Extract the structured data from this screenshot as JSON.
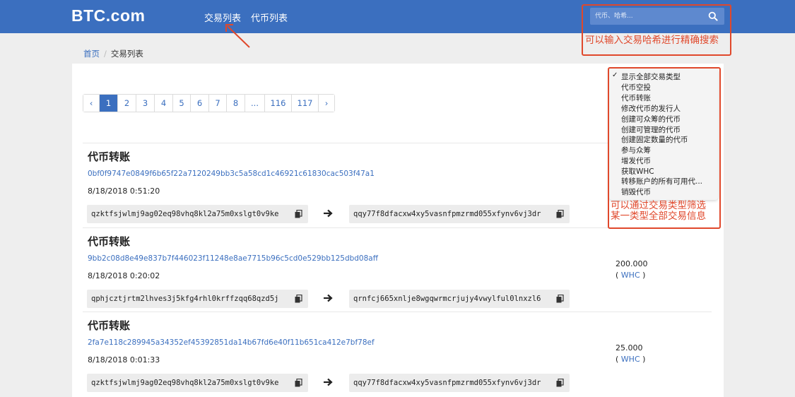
{
  "header": {
    "logo": "BTC.com",
    "nav": [
      "交易列表",
      "代币列表"
    ],
    "search_placeholder": "代币、哈希..."
  },
  "annotations": {
    "search": "可以输入交易哈希进行精确搜索",
    "filter_line1": "可以通过交易类型筛选",
    "filter_line2": "某一类型全部交易信息"
  },
  "breadcrumb": {
    "home": "首页",
    "separator": "/",
    "current": "交易列表"
  },
  "pagination": {
    "prev": "‹",
    "pages": [
      "1",
      "2",
      "3",
      "4",
      "5",
      "6",
      "7",
      "8",
      "...",
      "116",
      "117"
    ],
    "next": "›",
    "active": "1"
  },
  "filter_menu": {
    "selected": "显示全部交易类型",
    "options": [
      "显示全部交易类型",
      "代币空投",
      "代币转账",
      "修改代币的发行人",
      "创建可众筹的代币",
      "创建可管理的代币",
      "创建固定数量的代币",
      "参与众筹",
      "增发代币",
      "获取WHC",
      "转移账户的所有可用代...",
      "销毁代币"
    ]
  },
  "transactions": [
    {
      "type": "代币转账",
      "hash": "0bf0f9747e0849f6b65f22a7120249bb3c5a58cd1c46921c61830cac503f47a1",
      "time": "8/18/2018 0:51:20",
      "from": "qzktfsjwlmj9ag02eq98vhq8kl2a75m0xslgt0v9ke",
      "to": "qqy77f8dfacxw4xy5vasnfpmzrmd055xfynv6vj3dr",
      "amount": "",
      "token": ""
    },
    {
      "type": "代币转账",
      "hash": "9bb2c08d8e49e837b7f446023f11248e8ae7715b96c5cd0e529bb125dbd08aff",
      "time": "8/18/2018 0:20:02",
      "from": "qphjcztjrtm2lhves3j5kfg4rhl0krffzqq68qzd5j",
      "to": "qrnfcj665xnlje8wgqwrmcrjujy4vwylful0lnxzl6",
      "amount": "200.000",
      "token": "WHC"
    },
    {
      "type": "代币转账",
      "hash": "2fa7e118c289945a34352ef45392851da14b67fd6e40f11b651ca412e7bf78ef",
      "time": "8/18/2018 0:01:33",
      "from": "qzktfsjwlmj9ag02eq98vhq8kl2a75m0xslgt0v9ke",
      "to": "qqy77f8dfacxw4xy5vasnfpmzrmd055xfynv6vj3dr",
      "amount": "25.000",
      "token": "WHC"
    }
  ]
}
